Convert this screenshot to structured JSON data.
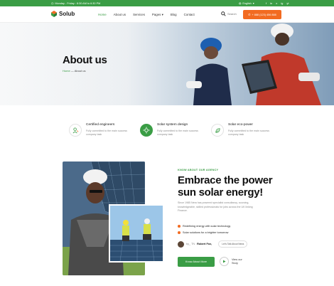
{
  "topbar": {
    "hours": "Monday - Friday : 8:30 AM to 6:30 PM",
    "language": "English",
    "social": [
      "f",
      "in",
      "x",
      "ig",
      "yt"
    ]
  },
  "header": {
    "logo_text": "Solub",
    "nav": [
      "Home",
      "About us",
      "Services",
      "Pages",
      "Blog",
      "Contact"
    ],
    "search_label": "Search",
    "call_label": "+ 888 (123) 456 888"
  },
  "hero": {
    "title": "About us",
    "breadcrumb_home": "Home",
    "breadcrumb_sep": "—",
    "breadcrumb_current": "About us"
  },
  "features": [
    {
      "icon": "engineer-icon",
      "title": "Certified engineers",
      "desc": "Fully committed to the main success company task"
    },
    {
      "icon": "solar-gear-icon",
      "title": "Solar system design",
      "desc": "Fully committed to the main success company task"
    },
    {
      "icon": "leaf-icon",
      "title": "Solar eco-power",
      "desc": "Fully committed to the main success company task"
    }
  ],
  "about": {
    "eyebrow": "KNOW ABOUT OUR AGENCY",
    "headline": "Embrace the power sun solar energy!",
    "paragraph": "Since 1985 Nera has powered specialist consultancy, sourcing, knowledgeable, skilled professionals for jobs across the UK linking Finance.",
    "checks": [
      "Redefining energy with solar technology",
      "Solar solutions for a brighter tomorrow"
    ],
    "author_by": "by_ TN",
    "author_name": "Robert Fox,",
    "author_chip": "Let's Talk About News",
    "button": "Know About More",
    "view_story": "View our Story"
  },
  "colors": {
    "green": "#3a9d45",
    "orange": "#f26b21"
  }
}
